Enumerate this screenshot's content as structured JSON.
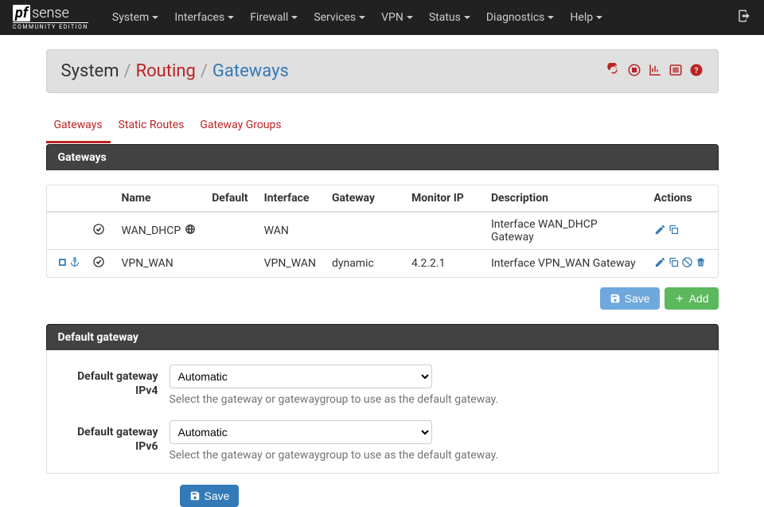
{
  "nav": {
    "items": [
      "System",
      "Interfaces",
      "Firewall",
      "Services",
      "VPN",
      "Status",
      "Diagnostics",
      "Help"
    ]
  },
  "logo": {
    "community": "COMMUNITY EDITION"
  },
  "breadcrumb": {
    "root": "System",
    "mid": "Routing",
    "current": "Gateways"
  },
  "tabs": [
    "Gateways",
    "Static Routes",
    "Gateway Groups"
  ],
  "gateways_panel": {
    "title": "Gateways",
    "headers": [
      "",
      "",
      "Name",
      "Default",
      "Interface",
      "Gateway",
      "Monitor IP",
      "Description",
      "Actions"
    ],
    "rows": [
      {
        "anchor": false,
        "status": "ok",
        "name": "WAN_DHCP",
        "globe": true,
        "default": "",
        "interface": "WAN",
        "gateway": "",
        "monitor": "",
        "description": "Interface WAN_DHCP Gateway",
        "actions": [
          "edit",
          "copy"
        ]
      },
      {
        "anchor": true,
        "status": "ok",
        "name": "VPN_WAN",
        "globe": false,
        "default": "",
        "interface": "VPN_WAN",
        "gateway": "dynamic",
        "monitor": "4.2.2.1",
        "description": "Interface VPN_WAN Gateway",
        "actions": [
          "edit",
          "copy",
          "disable",
          "delete"
        ]
      }
    ]
  },
  "buttons": {
    "save": "Save",
    "add": "Add"
  },
  "default_gw_panel": {
    "title": "Default gateway",
    "ipv4_label": "Default gateway IPv4",
    "ipv4_value": "Automatic",
    "ipv4_help": "Select the gateway or gatewaygroup to use as the default gateway.",
    "ipv6_label": "Default gateway IPv6",
    "ipv6_value": "Automatic",
    "ipv6_help": "Select the gateway or gatewaygroup to use as the default gateway.",
    "save": "Save"
  }
}
